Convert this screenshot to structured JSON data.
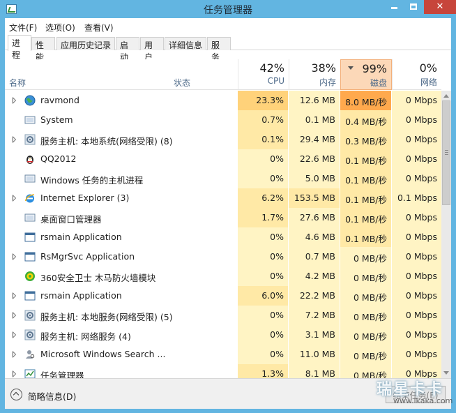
{
  "window": {
    "title": "任务管理器"
  },
  "menu": [
    {
      "label": "文件(F)"
    },
    {
      "label": "选项(O)"
    },
    {
      "label": "查看(V)"
    }
  ],
  "tabs": [
    {
      "label": "进程",
      "active": true
    },
    {
      "label": "性能"
    },
    {
      "label": "应用历史记录"
    },
    {
      "label": "启动"
    },
    {
      "label": "用户"
    },
    {
      "label": "详细信息"
    },
    {
      "label": "服务"
    }
  ],
  "columns": {
    "name": "名称",
    "status": "状态",
    "cpu": {
      "percent": "42%",
      "label": "CPU"
    },
    "memory": {
      "percent": "38%",
      "label": "内存"
    },
    "disk": {
      "percent": "99%",
      "label": "磁盘",
      "sorted": true
    },
    "network": {
      "percent": "0%",
      "label": "网络"
    }
  },
  "processes": [
    {
      "name": "ravmond",
      "expandable": true,
      "icon": "globe-icon",
      "cpu": "23.3%",
      "memory": "12.6 MB",
      "disk": "8.0 MB/秒",
      "network": "0 Mbps"
    },
    {
      "name": "System",
      "expandable": false,
      "icon": "window-icon",
      "cpu": "0.7%",
      "memory": "0.1 MB",
      "disk": "0.4 MB/秒",
      "network": "0 Mbps"
    },
    {
      "name": "服务主机: 本地系统(网络受限) (8)",
      "expandable": true,
      "icon": "gear-icon",
      "cpu": "0.1%",
      "memory": "29.4 MB",
      "disk": "0.3 MB/秒",
      "network": "0 Mbps"
    },
    {
      "name": "QQ2012",
      "expandable": false,
      "icon": "penguin-icon",
      "cpu": "0%",
      "memory": "22.6 MB",
      "disk": "0.1 MB/秒",
      "network": "0 Mbps"
    },
    {
      "name": "Windows 任务的主机进程",
      "expandable": false,
      "icon": "window-icon",
      "cpu": "0%",
      "memory": "5.0 MB",
      "disk": "0.1 MB/秒",
      "network": "0 Mbps"
    },
    {
      "name": "Internet Explorer (3)",
      "expandable": true,
      "icon": "ie-icon",
      "cpu": "6.2%",
      "memory": "153.5 MB",
      "disk": "0.1 MB/秒",
      "network": "0.1 Mbps"
    },
    {
      "name": "桌面窗口管理器",
      "expandable": false,
      "icon": "window-icon",
      "cpu": "1.7%",
      "memory": "27.6 MB",
      "disk": "0.1 MB/秒",
      "network": "0 Mbps"
    },
    {
      "name": "rsmain Application",
      "expandable": false,
      "icon": "app-window-icon",
      "cpu": "0%",
      "memory": "4.6 MB",
      "disk": "0.1 MB/秒",
      "network": "0 Mbps"
    },
    {
      "name": "RsMgrSvc Application",
      "expandable": true,
      "icon": "app-window-icon",
      "cpu": "0%",
      "memory": "0.7 MB",
      "disk": "0 MB/秒",
      "network": "0 Mbps"
    },
    {
      "name": "360安全卫士 木马防火墙模块",
      "expandable": false,
      "icon": "shield-360-icon",
      "cpu": "0%",
      "memory": "4.2 MB",
      "disk": "0 MB/秒",
      "network": "0 Mbps"
    },
    {
      "name": "rsmain Application",
      "expandable": true,
      "icon": "app-window-icon",
      "cpu": "6.0%",
      "memory": "22.2 MB",
      "disk": "0 MB/秒",
      "network": "0 Mbps"
    },
    {
      "name": "服务主机: 本地服务(网络受限) (5)",
      "expandable": true,
      "icon": "gear-icon",
      "cpu": "0%",
      "memory": "7.2 MB",
      "disk": "0 MB/秒",
      "network": "0 Mbps"
    },
    {
      "name": "服务主机: 网络服务 (4)",
      "expandable": true,
      "icon": "gear-icon",
      "cpu": "0%",
      "memory": "3.1 MB",
      "disk": "0 MB/秒",
      "network": "0 Mbps"
    },
    {
      "name": "Microsoft Windows Search ...",
      "expandable": true,
      "icon": "search-person-icon",
      "cpu": "0%",
      "memory": "11.0 MB",
      "disk": "0 MB/秒",
      "network": "0 Mbps"
    },
    {
      "name": "任务管理器",
      "expandable": true,
      "icon": "taskmgr-icon",
      "cpu": "1.3%",
      "memory": "8.1 MB",
      "disk": "0 MB/秒",
      "network": "0 Mbps"
    }
  ],
  "footer": {
    "fewer_details": "简略信息(D)",
    "end_task": "结束任务(E)"
  },
  "watermark": {
    "big": "瑞星卡卡",
    "small": "www.ikaka.com"
  },
  "colors": {
    "titlebar": "#62b5e1",
    "close_button": "#c7453b",
    "cell_light": "#fff4c4",
    "cell_mid": "#ffe9a6",
    "cell_high": "#ffd27a",
    "disk_sorted_header": "#fcd8b8",
    "disk_hot": "#ffa94d"
  }
}
